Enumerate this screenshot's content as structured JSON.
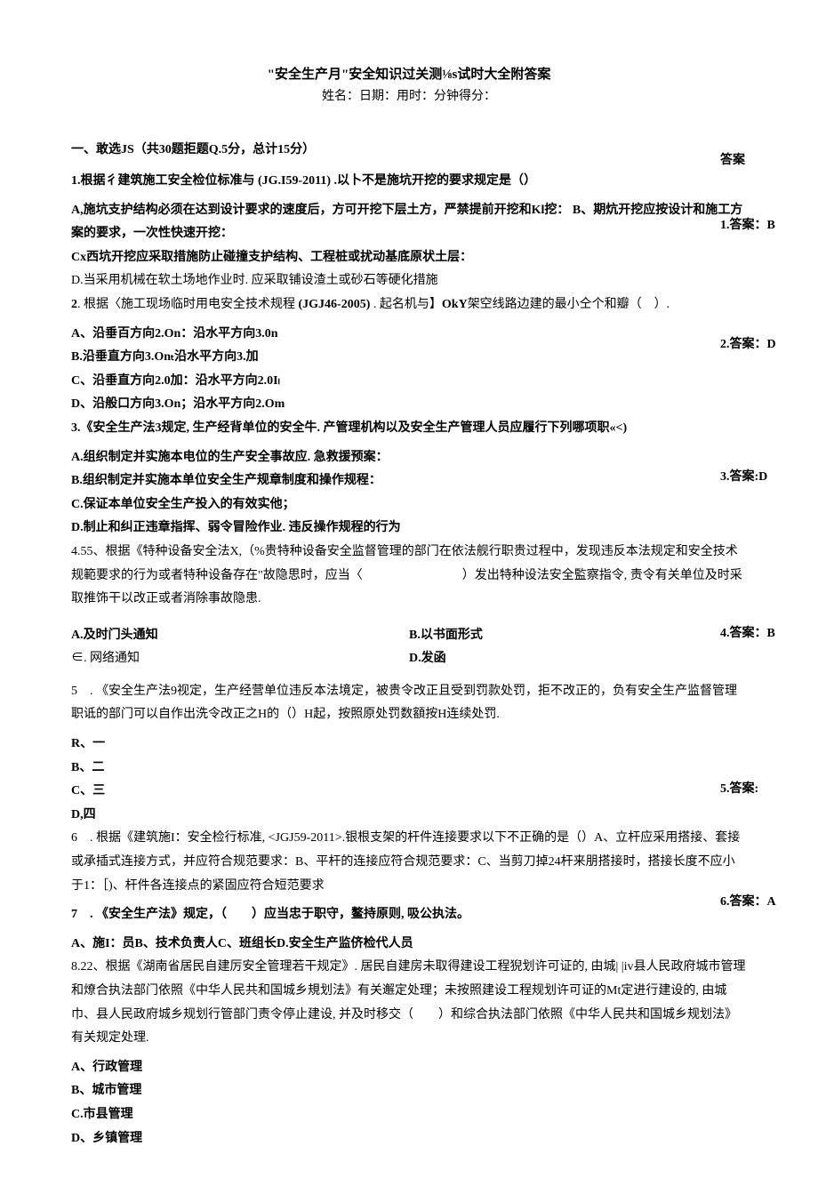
{
  "header": {
    "title": "\"安全生产月\"安全知识过关测⅛s试时大全附答案",
    "subtitle": "姓名：日期：用时：分钟得分："
  },
  "section": "一、敢选JS（共30题拒题Q.5分，总计15分）",
  "q1": {
    "stem": "1.根据彳建筑施工安全检位标准与 (JG.I59-2011) .以卜不是施坑开挖的要求规定是（）",
    "a": "A,施坑支护结构必须在达到设计要求的速度后，方可开挖下层土方，严禁提前开挖和Kl挖：",
    "b": "B、期炕开挖应按设计和施工方案的要求，一次性快速开挖：",
    "c": "Cx西坑开挖应采取措施防止碰撞支护结构、工程桩或扰动基底原状土层：",
    "d": "D.当采用机械在软土场地作业时. 应采取铺设渣土或砂石等硬化措施"
  },
  "q2": {
    "stem": "2. 根据〈施工现场临时用电安全技术规程 (JGJ46-2005) . 起名机与】OkY架空线路边建的最小仝个和瓣（　）.",
    "a": "A、沿垂百方向2.On：沿水平方向3.0n",
    "b": "B.沿垂直方向3.Onₜ沿水平方向3.加",
    "c": "C、沿垂直方向2.0加：沿水平方向2.0Iₗ",
    "d": "D、沿般口方向3.On；沿水平方向2.Om"
  },
  "q3": {
    "stem": "3.《安全生产法3规定, 生产经背单位的安全牛. 产管理机构以及安全生产管理人员应履行下列哪项职«<)",
    "a": "A.组织制定并实施本电位的生产安全事故应. 急救援预案：",
    "b": "B.组织制定并实施本单位安全生产规章制度和操作规程：",
    "c": "C.保证本单位安全生产投入的有效实他；",
    "d": "D.制止和纠正违章指挥、弱令冒险作业. 违反操作规程的行为"
  },
  "q4": {
    "stem": "4.55、根据《特种设备安全法X,（%贵特种设备安全监督管理的部门在依法舰行职贵过程中，发现违反本法规定和安全技术规範要求的行为或者特种设备存在\"故隐思时，应当〈　　　　　　　　）发出特种设法安全監察指令, 责令有关单位及时采取推饰干以改正或者消除事故隐患.",
    "a": "A.及时门头通知",
    "b": "B.以书面形式",
    "c": "∈. 网络通知",
    "d": "D.发函"
  },
  "q5": {
    "stem": "5　. 《安全生产法9视定，生产经营单位违反本法境定，被贵令改正且受到罚款处罚，拒不改正的，负有安全生产监督管理职诋的部门可以自作出洗令改正之H的（）H起，按照原处罚数額按H连续处罚.",
    "a": "R、一",
    "b": "B、二",
    "c": "C、三",
    "d": "D,四"
  },
  "q6": {
    "stem": "6　. 根据《建筑施I：安全检行标准, <JGJ59-2011>.银根支架的杆件连接要求以下不正确的是（）A、立杆应采用搭接、套接或承插式连接方式，并应符合规范要求：B、平杆的连接应符合规范要求：C、当剪刀掉24杆来朋搭接时，搭接长度不应小于1：［)、杆件各连接点的紧固应符合短范要求"
  },
  "q7": {
    "stem": "7　. 《安全生产法》规定，（　　）应当忠于职守，鳌持原则, 吸公执法。",
    "opts": "A、施I：员B、技术负责人C、班组长D.安全生产监侪检代人员"
  },
  "q8": {
    "stem": "8.22、根据《湖南省居民自建厉安全管理若干规定》. 居民自建房未取得建设工程猊划许可证的, 由城| |iv县人民政府城市管理和燎合执法部门依照《中华人民共和国城乡規划法》有关邂定处理；未按照建设工程规划许可证的Mt定进行建设的, 由城巾、县人民政府城乡规划行管部门责令停止建设, 并及时移交（　　）和综合执法部门依照《中华人民共和国城乡规划法》有关规定处理.",
    "a": "A、行政管理",
    "b": "B、城市管理",
    "c": "C.市县管理",
    "d": "D、乡镇管理"
  },
  "answers": {
    "label": "答案",
    "a1": "1.答案：B",
    "a2": "2.答案：D",
    "a3": "3.答案:D",
    "a4": "4.答案：B",
    "a5": "5.答案:",
    "a6": "6.答案：A"
  }
}
